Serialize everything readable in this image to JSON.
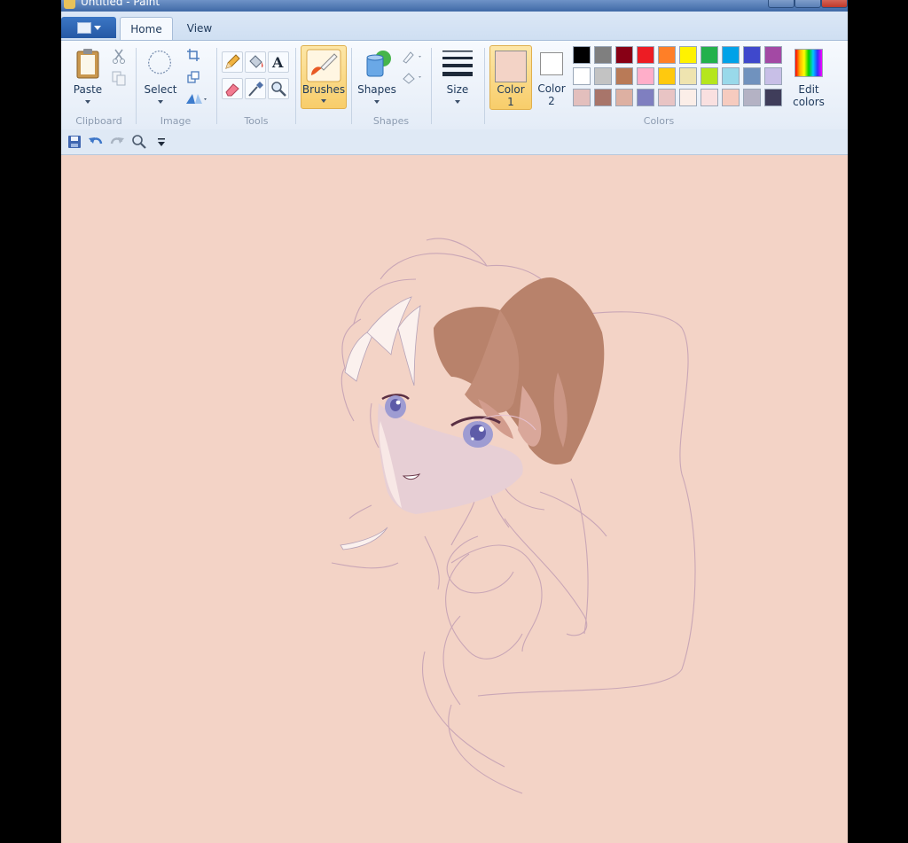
{
  "window": {
    "title": "Untitled - Paint"
  },
  "tabs": {
    "home": "Home",
    "view": "View"
  },
  "ribbon": {
    "clipboard": {
      "paste": "Paste",
      "group": "Clipboard"
    },
    "image": {
      "select": "Select",
      "group": "Image"
    },
    "tools": {
      "group": "Tools"
    },
    "brushes": {
      "label": "Brushes"
    },
    "shapes": {
      "label": "Shapes",
      "group": "Shapes"
    },
    "size": {
      "label": "Size"
    },
    "colors": {
      "color1_line1": "Color",
      "color1_line2": "1",
      "color2_line1": "Color",
      "color2_line2": "2",
      "edit_line1": "Edit",
      "edit_line2": "colors",
      "group": "Colors",
      "color1_value": "#f3d3c6",
      "color2_value": "#ffffff",
      "palette_row1": [
        "#000000",
        "#7f7f7f",
        "#880015",
        "#ed1c24",
        "#ff7f27",
        "#fff200",
        "#22b14c",
        "#00a2e8",
        "#3f48cc",
        "#a349a4"
      ],
      "palette_row2": [
        "#ffffff",
        "#c3c3c3",
        "#b97a57",
        "#ffaec9",
        "#ffc90e",
        "#efe4b0",
        "#b5e61d",
        "#99d9ea",
        "#7092be",
        "#c8bfe7"
      ],
      "palette_row3": [
        "#e3bfbd",
        "#a8756a",
        "#ddb0a2",
        "#7f7fc0",
        "#e8c4c4",
        "#fbeee8",
        "#f9e0e0",
        "#f6cbbf",
        "#b4b2c4",
        "#3f3d5a"
      ]
    }
  },
  "icons": {
    "paste": "clipboard-icon",
    "cut": "scissors-icon",
    "copy": "copy-icon",
    "select": "lasso-select-icon",
    "crop": "crop-icon",
    "resize": "resize-icon",
    "rotate": "rotate-icon",
    "pencil": "pencil-icon",
    "fill": "fill-bucket-icon",
    "text": "text-icon",
    "eraser": "eraser-icon",
    "picker": "color-picker-icon",
    "magnifier": "magnifier-icon",
    "brushes": "brush-icon",
    "shapes": "shapes-icon",
    "outline": "outline-icon",
    "shape-fill": "shape-fill-icon",
    "size": "line-size-icon",
    "edit-colors": "rainbow-icon",
    "save": "save-icon",
    "undo": "undo-icon",
    "redo": "redo-icon",
    "zoom": "zoom-icon",
    "qat-menu": "qat-dropdown-icon"
  },
  "canvas": {
    "background": "#f3d3c6",
    "hair_color": "#b8826b"
  }
}
